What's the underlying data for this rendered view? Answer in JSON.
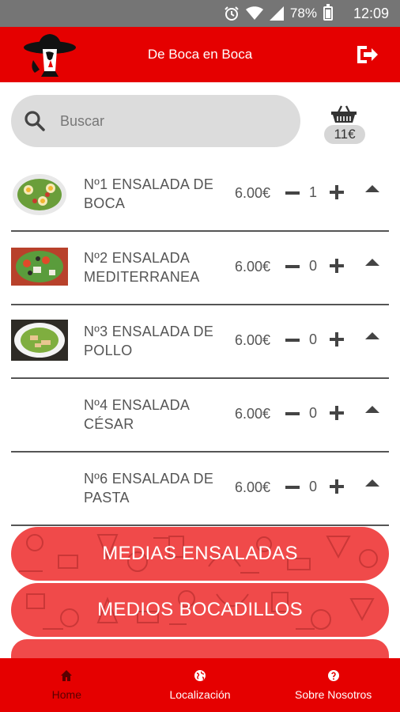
{
  "status_bar": {
    "battery": "78%",
    "time": "12:09"
  },
  "header": {
    "title": "De Boca en Boca",
    "logo_icon": "chef-hat-logo-icon",
    "logout_icon": "logout-icon"
  },
  "search": {
    "placeholder": "Buscar"
  },
  "cart": {
    "total": "11€",
    "icon": "basket-icon"
  },
  "products": [
    {
      "name": "Nº1 ENSALADA DE BOCA",
      "price": "6.00€",
      "quantity": "1",
      "has_image": true
    },
    {
      "name": "Nº2 ENSALADA MEDITERRANEA",
      "price": "6.00€",
      "quantity": "0",
      "has_image": true
    },
    {
      "name": "Nº3 ENSALADA DE POLLO",
      "price": "6.00€",
      "quantity": "0",
      "has_image": true
    },
    {
      "name": "Nº4 ENSALADA CÉSAR",
      "price": "6.00€",
      "quantity": "0",
      "has_image": false
    },
    {
      "name": "Nº6 ENSALADA DE PASTA",
      "price": "6.00€",
      "quantity": "0",
      "has_image": false
    }
  ],
  "categories": [
    {
      "label": "MEDIAS ENSALADAS"
    },
    {
      "label": "MEDIOS BOCADILLOS"
    }
  ],
  "bottom_nav": [
    {
      "label": "Home",
      "icon": "home-icon",
      "active": true
    },
    {
      "label": "Localización",
      "icon": "globe-icon",
      "active": false
    },
    {
      "label": "Sobre Nosotros",
      "icon": "help-icon",
      "active": false
    }
  ],
  "colors": {
    "primary": "#e50000",
    "category": "#f04a4a",
    "search_bg": "#dcdcdc",
    "status_bar": "#757575"
  }
}
